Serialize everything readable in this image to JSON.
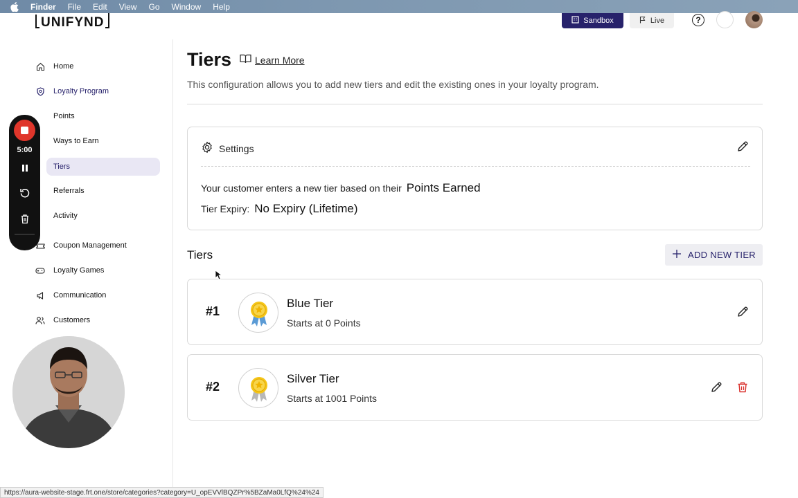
{
  "menubar": {
    "items": [
      "Finder",
      "File",
      "Edit",
      "View",
      "Go",
      "Window",
      "Help"
    ]
  },
  "header": {
    "logo": "UNIFYND",
    "sandbox_label": "Sandbox",
    "live_label": "Live",
    "help_symbol": "?"
  },
  "sidebar": {
    "home": "Home",
    "loyalty_program": "Loyalty Program",
    "points": "Points",
    "ways_to_earn": "Ways to Earn",
    "tiers": "Tiers",
    "referrals": "Referrals",
    "activity": "Activity",
    "coupon_management": "Coupon Management",
    "loyalty_games": "Loyalty Games",
    "communication": "Communication",
    "customers": "Customers"
  },
  "recorder": {
    "time": "5:00"
  },
  "main": {
    "title": "Tiers",
    "learn_more": "Learn More",
    "description": "This configuration allows you to add new tiers and edit the existing ones in your loyalty program.",
    "settings": {
      "title": "Settings",
      "entry_text": "Your customer enters a new tier based on their",
      "entry_value": "Points Earned",
      "expiry_label": "Tier Expiry:",
      "expiry_value": "No Expiry (Lifetime)"
    },
    "tiers_heading": "Tiers",
    "add_new_tier": "ADD NEW TIER",
    "tiers": [
      {
        "rank": "#1",
        "name": "Blue Tier",
        "starts": "Starts at 0 Points",
        "ribbon_color": "#5b9bd5"
      },
      {
        "rank": "#2",
        "name": "Silver Tier",
        "starts": "Starts at 1001 Points",
        "ribbon_color": "#b8b8b8"
      }
    ]
  },
  "status_url": "https://aura-website-stage.frt.one/store/categories?category=U_opEVVlBQZPr%5BZaMa0LfQ%24%24",
  "colors": {
    "brand": "#27226b",
    "active_nav_bg": "#e9e7f4",
    "delete": "#d9302c",
    "record": "#e0362b"
  }
}
